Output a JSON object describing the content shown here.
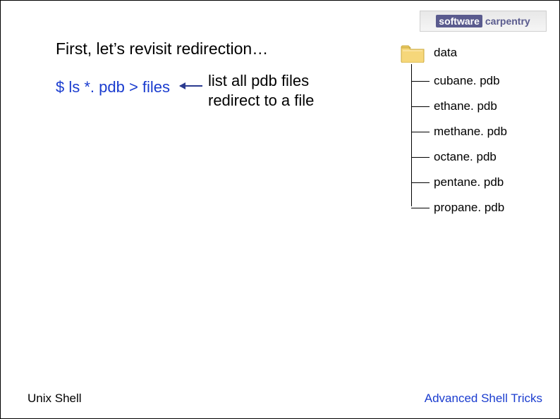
{
  "logo": {
    "left": "software",
    "right": "carpentry"
  },
  "heading": "First, let’s revisit redirection…",
  "command": "$ ls *. pdb > files",
  "annotation": {
    "line1": "list all pdb files",
    "line2": "redirect to a file"
  },
  "tree": {
    "root": "data",
    "children": [
      "cubane. pdb",
      "ethane. pdb",
      "methane. pdb",
      "octane. pdb",
      "pentane. pdb",
      "propane. pdb"
    ]
  },
  "footer": {
    "left": "Unix Shell",
    "right": "Advanced Shell Tricks"
  }
}
